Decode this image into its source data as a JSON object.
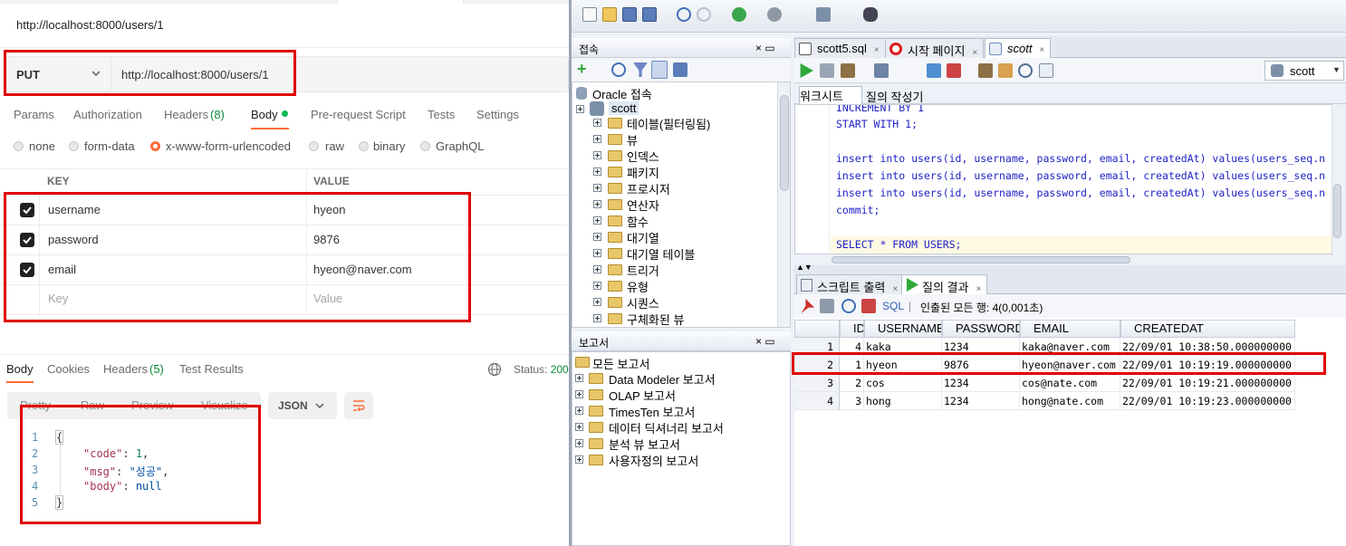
{
  "postman": {
    "url_title": "http://localhost:8000/users/1",
    "method": "PUT",
    "url": "http://localhost:8000/users/1",
    "request_tabs": [
      "Params",
      "Authorization",
      "Headers",
      "(8)",
      "Body",
      "Pre-request Script",
      "Tests",
      "Settings"
    ],
    "body_types": [
      "none",
      "form-data",
      "x-www-form-urlencoded",
      "raw",
      "binary",
      "GraphQL"
    ],
    "body_type_selected": "x-www-form-urlencoded",
    "kv_headers": {
      "key": "KEY",
      "value": "VALUE"
    },
    "kv_rows": [
      {
        "key": "username",
        "value": "hyeon"
      },
      {
        "key": "password",
        "value": "9876"
      },
      {
        "key": "email",
        "value": "hyeon@naver.com"
      }
    ],
    "kv_placeholder": {
      "key": "Key",
      "value": "Value"
    },
    "response_tabs": [
      "Body",
      "Cookies",
      "Headers",
      "(5)",
      "Test Results"
    ],
    "status_label": "Status:",
    "status_value": "200",
    "format_tabs": [
      "Pretty",
      "Raw",
      "Preview",
      "Visualize"
    ],
    "format_select": "JSON",
    "response_lines": {
      "l1": "{",
      "code_key": "\"code\"",
      "code_val": "1",
      "msg_key": "\"msg\"",
      "msg_val": "\"성공\"",
      "body_key": "\"body\"",
      "body_val": "null",
      "l5": "}"
    },
    "line_numbers": [
      "1",
      "2",
      "3",
      "4",
      "5"
    ]
  },
  "sqldev": {
    "connections_title": "접속",
    "reports_title": "보고서",
    "panel_buttons": "× ▭",
    "tree_root": "Oracle 접속",
    "tree_conn": "scott",
    "tree_items": [
      "테이블(필터링됨)",
      "뷰",
      "인덱스",
      "패키지",
      "프로시저",
      "연산자",
      "함수",
      "대기열",
      "대기열 테이블",
      "트리거",
      "유형",
      "시퀀스",
      "구체화된 뷰"
    ],
    "reports_root": "모든 보고서",
    "report_items": [
      "Data Modeler 보고서",
      "OLAP 보고서",
      "TimesTen 보고서",
      "데이터 딕셔너리 보고서",
      "분석 뷰 보고서",
      "사용자정의 보고서"
    ],
    "editor_tabs": [
      "scott5.sql",
      "시작 페이지",
      "scott"
    ],
    "connection_select": "scott",
    "worksheet_tabs": [
      "워크시트",
      "질의 작성기"
    ],
    "sql_lines": [
      "INCREMENT BY 1",
      "START WITH 1;",
      "",
      "insert into users(id, username, password, email, createdAt) values(users_seq.n",
      "insert into users(id, username, password, email, createdAt) values(users_seq.n",
      "insert into users(id, username, password, email, createdAt) values(users_seq.n",
      "commit;",
      "",
      "SELECT * FROM USERS;"
    ],
    "result_tabs": [
      "스크립트 출력",
      "질의 결과"
    ],
    "result_info_sql": "SQL",
    "result_info": "인출된 모든 행: 4(0,001초)",
    "columns": [
      "ID",
      "USERNAME",
      "PASSWORD",
      "EMAIL",
      "CREATEDAT"
    ],
    "rows": [
      {
        "n": "1",
        "id": "4",
        "username": "kaka",
        "password": "1234",
        "email": "kaka@naver.com",
        "createdat": "22/09/01 10:38:50.000000000"
      },
      {
        "n": "2",
        "id": "1",
        "username": "hyeon",
        "password": "9876",
        "email": "hyeon@naver.com",
        "createdat": "22/09/01 10:19:19.000000000"
      },
      {
        "n": "3",
        "id": "2",
        "username": "cos",
        "password": "1234",
        "email": "cos@nate.com",
        "createdat": "22/09/01 10:19:21.000000000"
      },
      {
        "n": "4",
        "id": "3",
        "username": "hong",
        "password": "1234",
        "email": "hong@nate.com",
        "createdat": "22/09/01 10:19:23.000000000"
      }
    ]
  },
  "colors": {
    "highlight_box": "#e00000",
    "postman_orange": "#ff6c37",
    "status_green": "#0a8a37",
    "sql_keyword": "#1f22c7"
  }
}
